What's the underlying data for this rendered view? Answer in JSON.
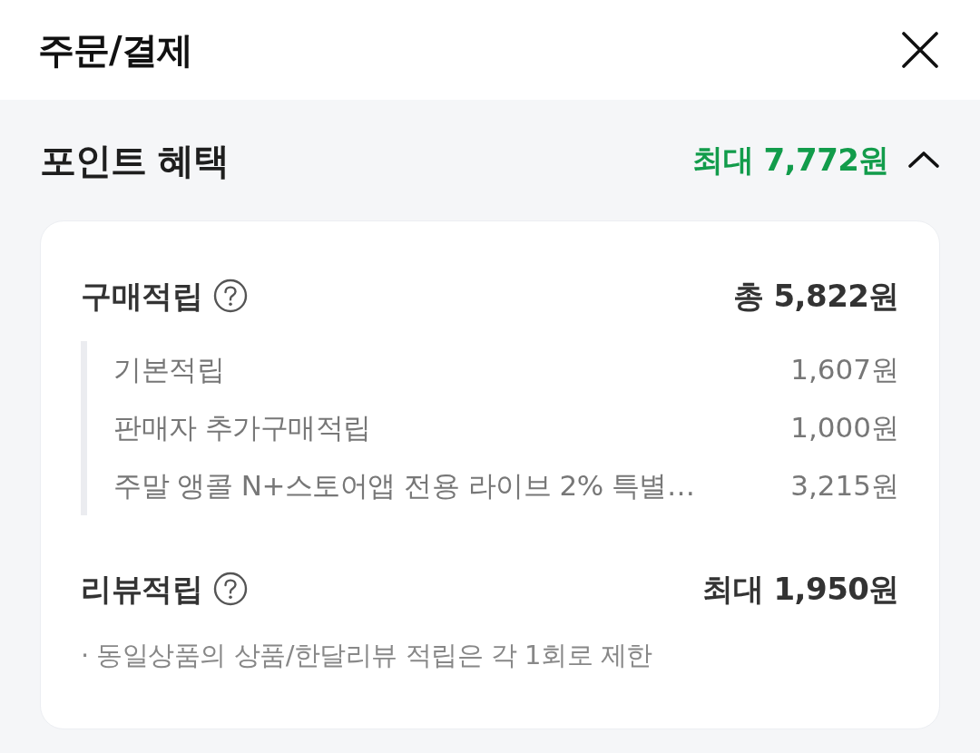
{
  "header": {
    "title": "주문/결제"
  },
  "section": {
    "title": "포인트 혜택",
    "summary": "최대 7,772원",
    "expanded": true,
    "groups": [
      {
        "title": "구매적립",
        "total": "총 5,822원",
        "items": [
          {
            "label": "기본적립",
            "amount": "1,607원"
          },
          {
            "label": "판매자 추가구매적립",
            "amount": "1,000원"
          },
          {
            "label": "주말 앵콜 N+스토어앱 전용 라이브 2% 특별…",
            "amount": "3,215원"
          }
        ]
      },
      {
        "title": "리뷰적립",
        "total": "최대 1,950원",
        "notes": [
          "· 동일상품의 상품/한달리뷰 적립은 각 1회로 제한"
        ]
      }
    ]
  }
}
